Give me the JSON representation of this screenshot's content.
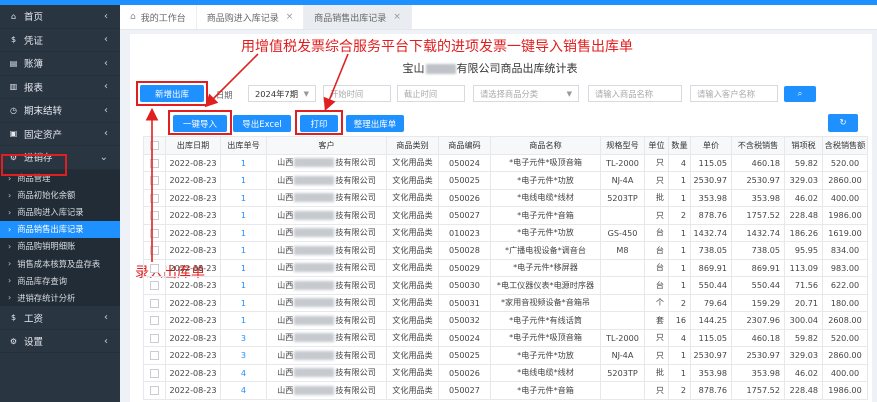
{
  "colors": {
    "accent": "#1e90ff",
    "sidebar_bg": "#2a3542",
    "annotation": "#e02020"
  },
  "sidebar": {
    "items_top": [
      {
        "icon": "home-icon",
        "glyph": "⌂",
        "label": "首页"
      },
      {
        "icon": "dollar-icon",
        "glyph": "$",
        "label": "凭证"
      },
      {
        "icon": "book-icon",
        "glyph": "▤",
        "label": "账簿"
      },
      {
        "icon": "report-icon",
        "glyph": "▥",
        "label": "报表"
      },
      {
        "icon": "clock-icon",
        "glyph": "◷",
        "label": "期末结转"
      },
      {
        "icon": "asset-icon",
        "glyph": "▣",
        "label": "固定资产"
      },
      {
        "icon": "inventory-icon",
        "glyph": "⚙",
        "label": "进销存"
      }
    ],
    "sub_items": [
      {
        "label": "商品管理"
      },
      {
        "label": "商品初始化余额"
      },
      {
        "label": "商品购进入库记录"
      },
      {
        "label": "商品销售出库记录"
      },
      {
        "label": "商品购销明细账"
      },
      {
        "label": "销售成本核算及盘存表"
      },
      {
        "label": "商品库存查询"
      },
      {
        "label": "进销存统计分析"
      }
    ],
    "items_bottom": [
      {
        "icon": "salary-icon",
        "glyph": "$",
        "label": "工资"
      },
      {
        "icon": "settings-icon",
        "glyph": "⚙",
        "label": "设置"
      }
    ]
  },
  "tabs": [
    {
      "label": "我的工作台"
    },
    {
      "label": "商品购进入库记录"
    },
    {
      "label": "商品销售出库记录"
    }
  ],
  "annotations": {
    "top": "用增值税发票综合服务平台下载的进项发票一键导入销售出库单",
    "left": "录入出库单"
  },
  "report_title": {
    "prefix": "宝山",
    "suffix": "有限公司商品出库统计表"
  },
  "filters": {
    "new_btn": "新增出库",
    "date_label": "日期",
    "period_value": "2024年7期",
    "start_placeholder": "开始时间",
    "end_placeholder": "截止时间",
    "category_placeholder": "请选择商品分类",
    "product_placeholder": "请输入商品名称",
    "customer_placeholder": "请输入客户名称"
  },
  "actions": {
    "import": "一键导入",
    "export": "导出Excel",
    "print": "打印",
    "organize": "整理出库单"
  },
  "table": {
    "headers": [
      "",
      "出库日期",
      "出库单号",
      "客户",
      "商品类别",
      "商品编码",
      "商品名称",
      "规格型号",
      "单位",
      "数量",
      "单价",
      "不含税销售",
      "销项税",
      "含税销售额"
    ],
    "rows": [
      [
        "2022-08-23",
        "1",
        "山西",
        "技有限公司",
        "文化用品类",
        "050024",
        "*电子元件*吸顶音箱",
        "TL-2000",
        "只",
        "4",
        "115.05",
        "460.18",
        "59.82",
        "520.00"
      ],
      [
        "2022-08-23",
        "1",
        "山西",
        "技有限公司",
        "文化用品类",
        "050025",
        "*电子元件*功放",
        "NJ-4A",
        "只",
        "1",
        "2530.97",
        "2530.97",
        "329.03",
        "2860.00"
      ],
      [
        "2022-08-23",
        "1",
        "山西",
        "技有限公司",
        "文化用品类",
        "050026",
        "*电线电缆*线材",
        "5203TP",
        "批",
        "1",
        "353.98",
        "353.98",
        "46.02",
        "400.00"
      ],
      [
        "2022-08-23",
        "1",
        "山西",
        "技有限公司",
        "文化用品类",
        "050027",
        "*电子元件*音箱",
        "",
        "只",
        "2",
        "878.76",
        "1757.52",
        "228.48",
        "1986.00"
      ],
      [
        "2022-08-23",
        "1",
        "山西",
        "技有限公司",
        "文化用品类",
        "010023",
        "*电子元件*功放",
        "GS-450",
        "台",
        "1",
        "1432.74",
        "1432.74",
        "186.26",
        "1619.00"
      ],
      [
        "2022-08-23",
        "1",
        "山西",
        "技有限公司",
        "文化用品类",
        "050028",
        "*广播电视设备*调音台",
        "M8",
        "台",
        "1",
        "738.05",
        "738.05",
        "95.95",
        "834.00"
      ],
      [
        "2022-08-23",
        "1",
        "山西",
        "技有限公司",
        "文化用品类",
        "050029",
        "*电子元件*移屏器",
        "",
        "台",
        "1",
        "869.91",
        "869.91",
        "113.09",
        "983.00"
      ],
      [
        "2022-08-23",
        "1",
        "山西",
        "技有限公司",
        "文化用品类",
        "050030",
        "*电工仪器仪表*电源时序器",
        "",
        "台",
        "1",
        "550.44",
        "550.44",
        "71.56",
        "622.00"
      ],
      [
        "2022-08-23",
        "1",
        "山西",
        "技有限公司",
        "文化用品类",
        "050031",
        "*家用音视频设备*音箱吊",
        "",
        "个",
        "2",
        "79.64",
        "159.29",
        "20.71",
        "180.00"
      ],
      [
        "2022-08-23",
        "1",
        "山西",
        "技有限公司",
        "文化用品类",
        "050032",
        "*电子元件*有线话筒",
        "",
        "套",
        "16",
        "144.25",
        "2307.96",
        "300.04",
        "2608.00"
      ],
      [
        "2022-08-23",
        "3",
        "山西",
        "技有限公司",
        "文化用品类",
        "050024",
        "*电子元件*吸顶音箱",
        "TL-2000",
        "只",
        "4",
        "115.05",
        "460.18",
        "59.82",
        "520.00"
      ],
      [
        "2022-08-23",
        "3",
        "山西",
        "技有限公司",
        "文化用品类",
        "050025",
        "*电子元件*功放",
        "NJ-4A",
        "只",
        "1",
        "2530.97",
        "2530.97",
        "329.03",
        "2860.00"
      ],
      [
        "2022-08-23",
        "4",
        "山西",
        "技有限公司",
        "文化用品类",
        "050026",
        "*电线电缆*线材",
        "5203TP",
        "批",
        "1",
        "353.98",
        "353.98",
        "46.02",
        "400.00"
      ],
      [
        "2022-08-23",
        "4",
        "山西",
        "技有限公司",
        "文化用品类",
        "050027",
        "*电子元件*音箱",
        "",
        "只",
        "2",
        "878.76",
        "1757.52",
        "228.48",
        "1986.00"
      ]
    ]
  }
}
